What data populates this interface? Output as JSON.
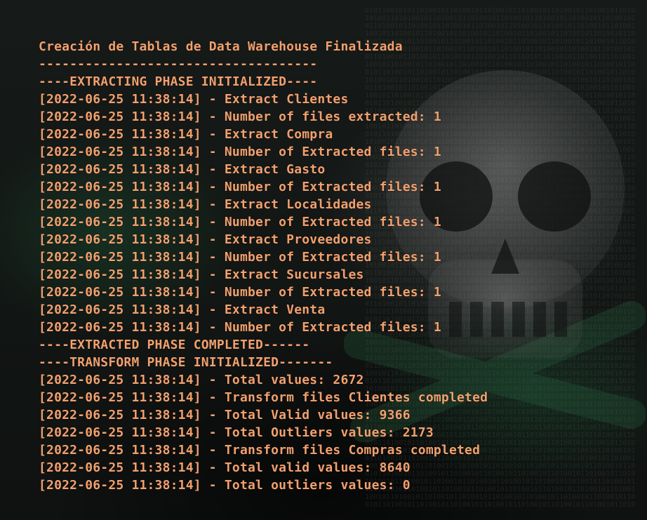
{
  "console": {
    "lines": [
      "Creación de Tablas de Data Warehouse Finalizada",
      "------------------------------------",
      "----EXTRACTING PHASE INITIALIZED----",
      "[2022-06-25 11:38:14] - Extract Clientes",
      "[2022-06-25 11:38:14] - Number of files extracted: 1",
      "[2022-06-25 11:38:14] - Extract Compra",
      "[2022-06-25 11:38:14] - Number of Extracted files: 1",
      "[2022-06-25 11:38:14] - Extract Gasto",
      "[2022-06-25 11:38:14] - Number of Extracted files: 1",
      "[2022-06-25 11:38:14] - Extract Localidades",
      "[2022-06-25 11:38:14] - Number of Extracted files: 1",
      "[2022-06-25 11:38:14] - Extract Proveedores",
      "[2022-06-25 11:38:14] - Number of Extracted files: 1",
      "[2022-06-25 11:38:14] - Extract Sucursales",
      "[2022-06-25 11:38:14] - Number of Extracted files: 1",
      "[2022-06-25 11:38:14] - Extract Venta",
      "[2022-06-25 11:38:14] - Number of Extracted files: 1",
      "----EXTRACTED PHASE COMPLETED------",
      "----TRANSFORM PHASE INITIALIZED-------",
      "[2022-06-25 11:38:14] - Total values: 2672",
      "[2022-06-25 11:38:14] - Transform files Clientes completed",
      "[2022-06-25 11:38:14] - Total Valid values: 9366",
      "[2022-06-25 11:38:14] - Total Outliers values: 2173",
      "[2022-06-25 11:38:14] - Transform files Compras completed",
      "[2022-06-25 11:38:14] - Total valid values: 8640",
      "[2022-06-25 11:38:14] - Total outliers values: 0"
    ]
  },
  "colors": {
    "text": "#f2a06e",
    "background": "#111514"
  },
  "background_image": {
    "icon": "skull-crossbones-icon"
  }
}
